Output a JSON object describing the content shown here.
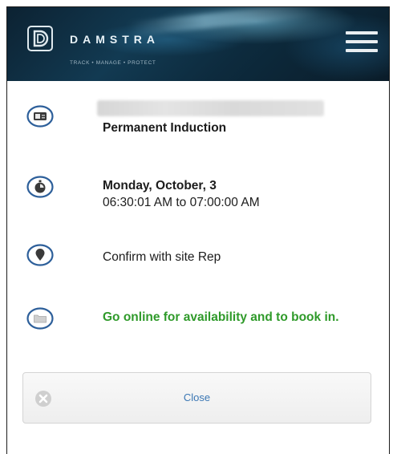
{
  "header": {
    "brand": "DAMSTRA",
    "tagline": "TRACK • MANAGE • PROTECT",
    "menu_icon": "hamburger-menu-icon",
    "logo_icon": "damstra-logo-icon"
  },
  "details": {
    "induction": {
      "icon": "id-card-icon",
      "title": "Permanent Induction"
    },
    "schedule": {
      "icon": "stopwatch-icon",
      "date": "Monday, October, 3",
      "time": "06:30:01 AM to 07:00:00 AM"
    },
    "location": {
      "icon": "map-pin-icon",
      "text": "Confirm with site Rep"
    },
    "booking": {
      "icon": "folder-icon",
      "text": "Go online for availability and to book in."
    }
  },
  "close_button": {
    "label": "Close",
    "icon": "close-circle-icon"
  },
  "colors": {
    "icon_blue": "#2d5f9a",
    "link_blue": "#3b77b4",
    "booking_green": "#2f9a2a",
    "header_dark": "#0d2b3e"
  }
}
